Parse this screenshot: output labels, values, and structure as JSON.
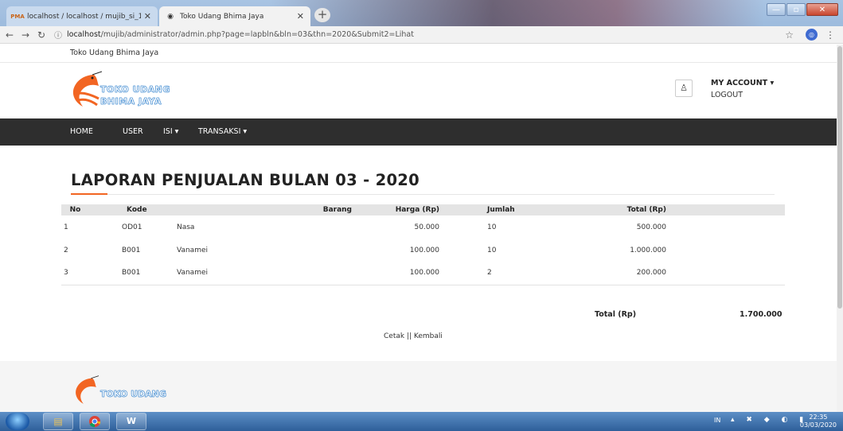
{
  "browser": {
    "tabs": [
      {
        "title": "localhost / localhost / mujib_si_1",
        "active": false,
        "icon": "phpmyadmin-icon"
      },
      {
        "title": "Toko Udang Bhima Jaya",
        "active": true,
        "icon": "globe-icon"
      }
    ],
    "new_tab": "+",
    "url_host": "localhost",
    "url_path": "/mujib/administrator/admin.php?page=lapbln&bln=03&thn=2020&Submit2=Lihat"
  },
  "site": {
    "top_title": "Toko Udang Bhima Jaya",
    "logo_line1": "TOKO UDANG",
    "logo_line2": "BHIMA JAYA",
    "account": {
      "title": "MY ACCOUNT ▾",
      "logout": "LOGOUT"
    },
    "nav": [
      "HOME",
      "USER",
      "ISI ▾",
      "TRANSAKSI ▾"
    ]
  },
  "report": {
    "heading": "LAPORAN PENJUALAN BULAN 03 - 2020",
    "columns": [
      "No",
      "Kode",
      "Barang",
      "Harga (Rp)",
      "Jumlah",
      "Total (Rp)"
    ],
    "rows": [
      [
        "1",
        "OD01",
        "Nasa",
        "50.000",
        "10",
        "500.000"
      ],
      [
        "2",
        "B001",
        "Vanamei",
        "100.000",
        "10",
        "1.000.000"
      ],
      [
        "3",
        "B001",
        "Vanamei",
        "100.000",
        "2",
        "200.000"
      ]
    ],
    "grand_total_label": "Total (Rp)",
    "grand_total_value": "1.700.000",
    "actions": "Cetak || Kembali"
  },
  "footer": {
    "logo_line1": "TOKO UDANG"
  },
  "taskbar": {
    "lang": "IN",
    "time": "22:35",
    "date": "03/03/2020"
  },
  "colors": {
    "accent": "#f26522",
    "navbar": "#2e2e2e",
    "logo_text": "#1e76c9"
  }
}
